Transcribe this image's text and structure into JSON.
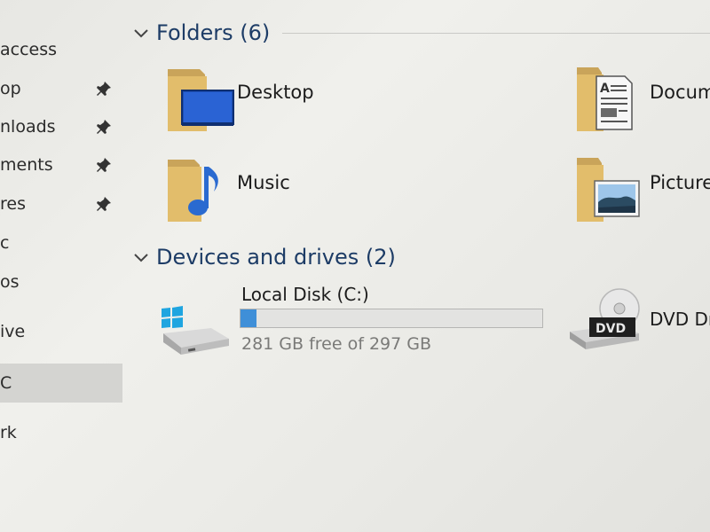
{
  "sidebar": {
    "items": [
      {
        "label": "access",
        "pinned": false,
        "selected": false
      },
      {
        "label": "op",
        "pinned": true,
        "selected": false
      },
      {
        "label": "nloads",
        "pinned": true,
        "selected": false
      },
      {
        "label": "ments",
        "pinned": true,
        "selected": false
      },
      {
        "label": "res",
        "pinned": true,
        "selected": false
      },
      {
        "label": "c",
        "pinned": false,
        "selected": false
      },
      {
        "label": "os",
        "pinned": false,
        "selected": false
      },
      {
        "label": "ive",
        "pinned": false,
        "selected": false
      },
      {
        "label": "C",
        "pinned": false,
        "selected": true
      },
      {
        "label": "rk",
        "pinned": false,
        "selected": false
      }
    ],
    "pin_icon": "pin-icon"
  },
  "folders_section": {
    "title": "Folders (6)",
    "items": [
      {
        "label": "Desktop",
        "icon": "desktop-folder-icon"
      },
      {
        "label": "Docum",
        "icon": "documents-folder-icon"
      },
      {
        "label": "Music",
        "icon": "music-folder-icon"
      },
      {
        "label": "Picture",
        "icon": "pictures-folder-icon"
      }
    ]
  },
  "devices_section": {
    "title": "Devices and drives (2)",
    "drives": [
      {
        "label": "Local Disk (C:)",
        "free_text": "281 GB free of 297 GB",
        "used_fraction": 0.054,
        "icon": "windows-drive-icon"
      },
      {
        "label": "DVD Dr",
        "icon": "dvd-drive-icon",
        "badge": "DVD"
      }
    ]
  },
  "colors": {
    "header_text": "#1d3c66",
    "bar_fill": "#3f8fd8",
    "folder": "#e2bd6b",
    "selection": "#d4d4d1"
  }
}
